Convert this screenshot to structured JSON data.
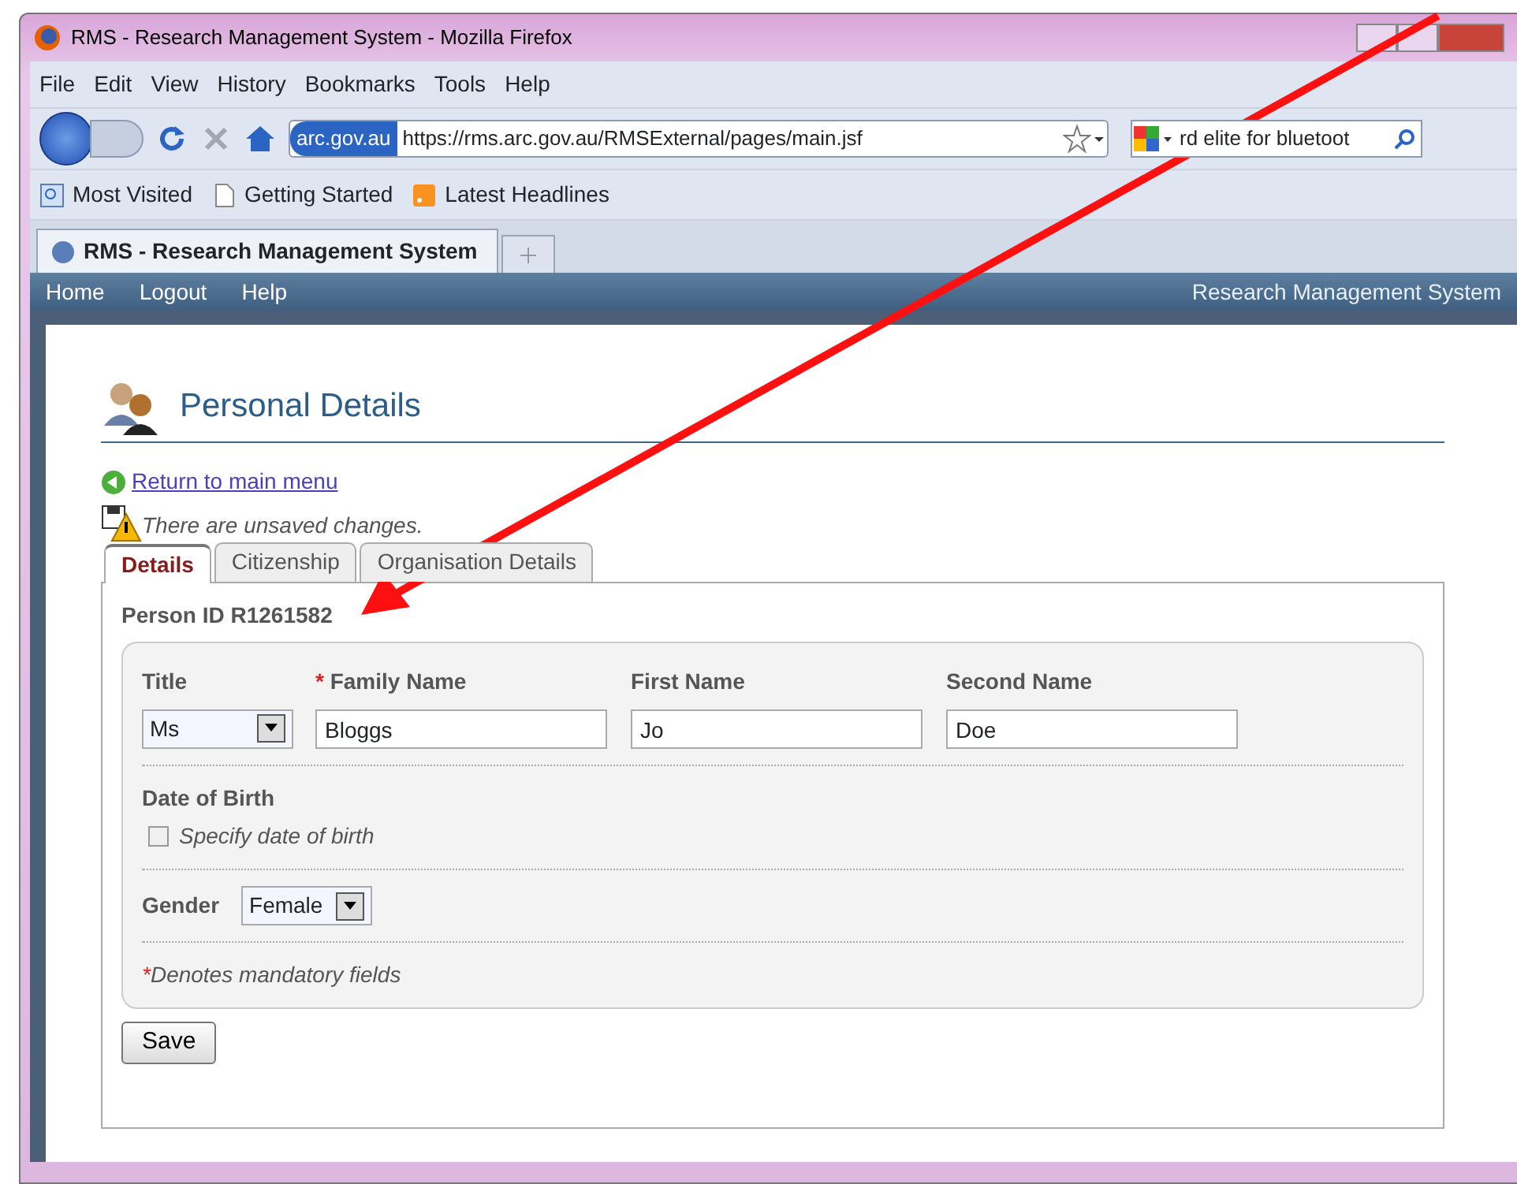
{
  "window": {
    "title": "RMS - Research Management System - Mozilla Firefox"
  },
  "menu": [
    "File",
    "Edit",
    "View",
    "History",
    "Bookmarks",
    "Tools",
    "Help"
  ],
  "toolbar": {
    "site_badge": "arc.gov.au",
    "url": "https://rms.arc.gov.au/RMSExternal/pages/main.jsf",
    "search": "rd elite for bluetoot"
  },
  "bookmarks": [
    {
      "label": "Most Visited",
      "kind": "search"
    },
    {
      "label": "Getting Started",
      "kind": "page"
    },
    {
      "label": "Latest Headlines",
      "kind": "feed"
    }
  ],
  "browser_tabs": [
    {
      "label": "RMS - Research Management System",
      "selected": true
    }
  ],
  "site_nav": {
    "links": [
      "Home",
      "Logout",
      "Help"
    ],
    "brand": "Research Management System"
  },
  "page": {
    "heading": "Personal Details",
    "return_link": "Return to main menu",
    "warning": "There are unsaved changes.",
    "tabs": [
      {
        "label": "Details",
        "selected": true
      },
      {
        "label": "Citizenship",
        "selected": false
      },
      {
        "label": "Organisation Details",
        "selected": false
      }
    ],
    "person_id": "Person ID R1261582",
    "required_mark": "*",
    "fields": [
      {
        "label": "Title",
        "required": false,
        "kind": "select",
        "value": "Ms"
      },
      {
        "label": "Family Name",
        "required": true,
        "kind": "text",
        "value": "Bloggs"
      },
      {
        "label": "First Name",
        "required": false,
        "kind": "text",
        "value": "Jo"
      },
      {
        "label": "Second Name",
        "required": false,
        "kind": "text",
        "value": "Doe"
      }
    ],
    "dob": {
      "label": "Date of Birth",
      "checkbox_label": "Specify date of birth",
      "checked": false
    },
    "gender": {
      "label": "Gender",
      "value": "Female"
    },
    "note": "Denotes mandatory fields",
    "save": "Save"
  }
}
